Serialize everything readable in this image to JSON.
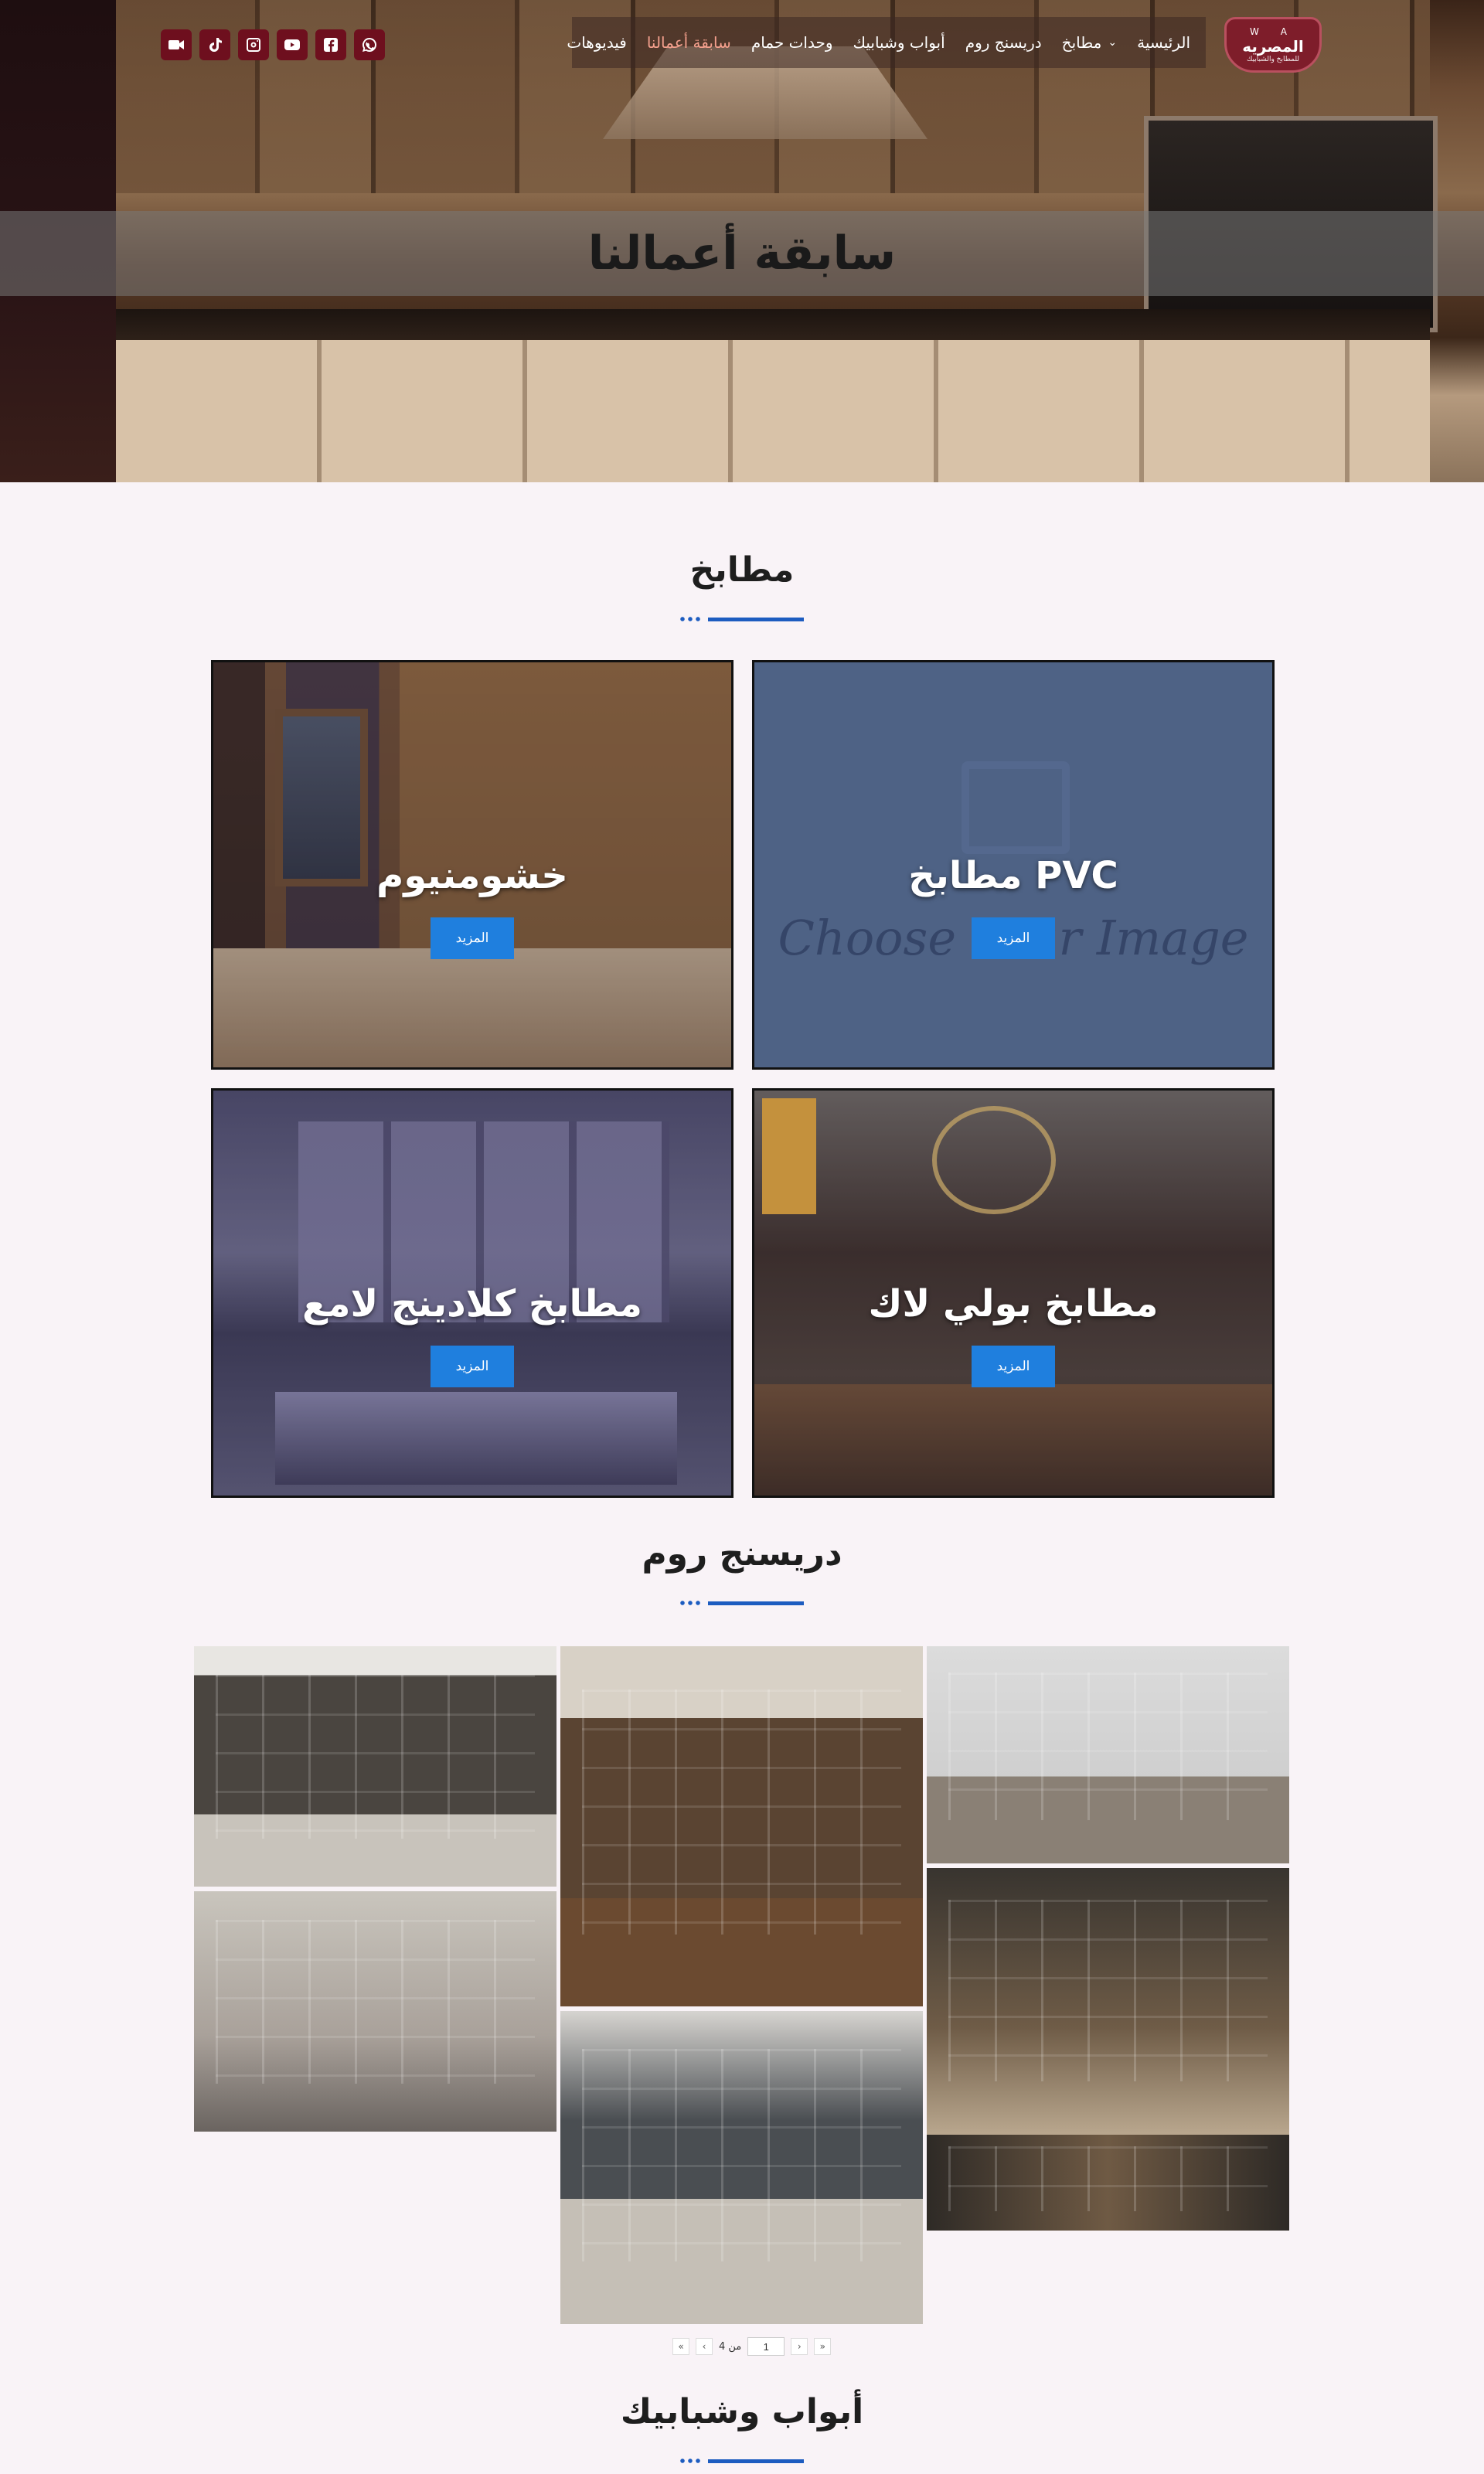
{
  "hero": {
    "title": "سابقة أعمالنا"
  },
  "logo": {
    "top": "W  A",
    "name": "المصريه",
    "sub": "للمطابخ والشبابيك"
  },
  "nav": {
    "items": [
      {
        "label": "الرئيسية",
        "active": false
      },
      {
        "label": "مطابخ",
        "has_dropdown": true,
        "active": false
      },
      {
        "label": "دريسنج روم",
        "active": false
      },
      {
        "label": "أبواب وشبابيك",
        "active": false
      },
      {
        "label": "وحدات حمام",
        "active": false
      },
      {
        "label": "سابقة أعمالنا",
        "active": true
      },
      {
        "label": "فيديوهات",
        "active": false
      }
    ],
    "active_color": "#f4a08d"
  },
  "socials": [
    {
      "icon": "video-camera-icon"
    },
    {
      "icon": "tiktok-icon"
    },
    {
      "icon": "instagram-icon"
    },
    {
      "icon": "youtube-icon"
    },
    {
      "icon": "facebook-icon"
    },
    {
      "icon": "whatsapp-icon"
    }
  ],
  "sections": {
    "kitchens": {
      "title": "مطابخ",
      "cards": [
        {
          "title": "خشومنيوم",
          "button": "المزيد"
        },
        {
          "title": "مطابخ PVC",
          "button": "المزيد",
          "placeholder_text": "Choose Your Image"
        },
        {
          "title": "مطابخ كلادينج لامع",
          "button": "المزيد"
        },
        {
          "title": "مطابخ بولي لاك",
          "button": "المزيد"
        }
      ]
    },
    "dressing": {
      "title": "دريسنج روم"
    },
    "doors": {
      "title": "أبواب وشبابيك"
    }
  },
  "pagination": {
    "first": "«",
    "prev": "‹",
    "current": "1",
    "of_text": "من 4",
    "next": "›",
    "last": "»"
  },
  "colors": {
    "accent": "#1f7fde",
    "divider": "#1d5cc0",
    "social_bg": "#6e0f1e",
    "logo_bg": "#7e1d2a",
    "page_bg": "#f9f3f7"
  }
}
